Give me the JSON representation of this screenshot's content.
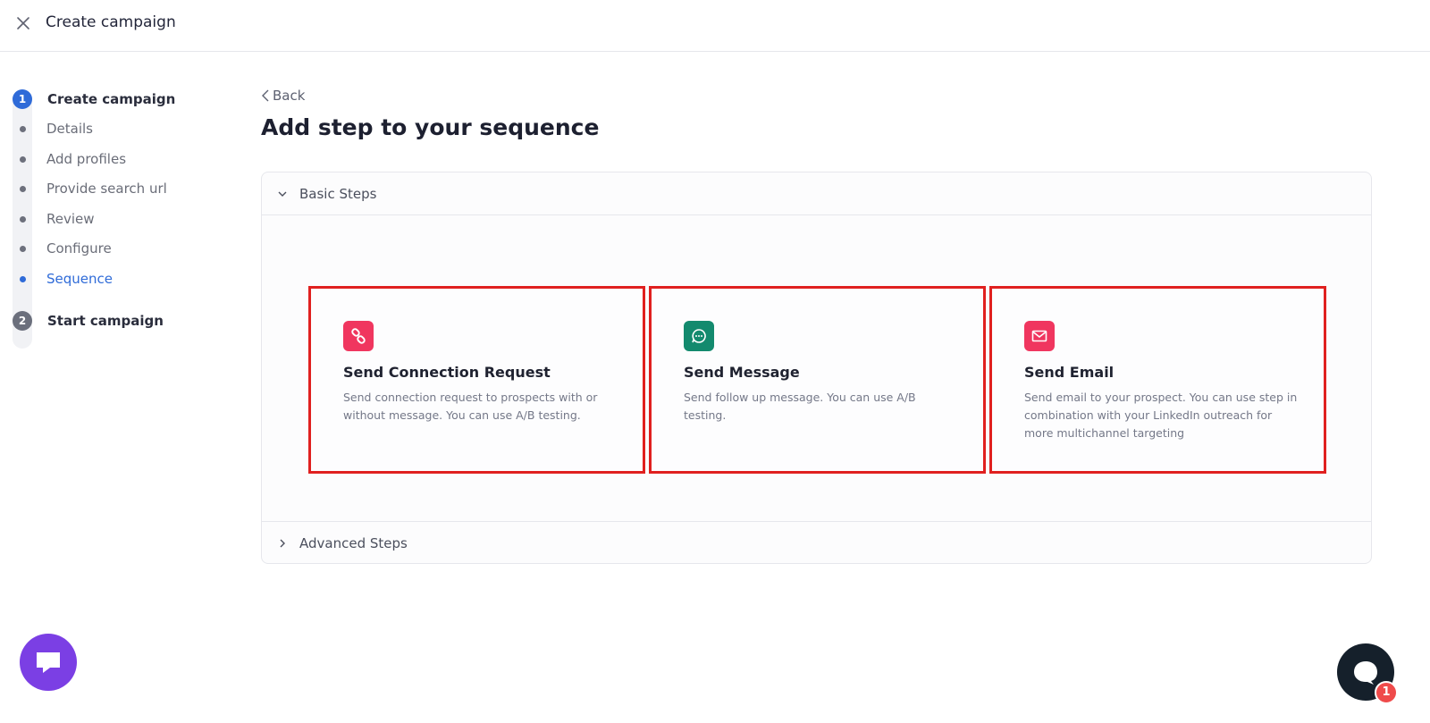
{
  "header": {
    "title": "Create campaign",
    "close_icon": "close-icon"
  },
  "stepper": {
    "steps": [
      {
        "number": "1",
        "label": "Create campaign",
        "state": "active"
      },
      {
        "number": "2",
        "label": "Start campaign",
        "state": "inactive"
      }
    ],
    "substeps": [
      {
        "label": "Details"
      },
      {
        "label": "Add profiles"
      },
      {
        "label": "Provide search url"
      },
      {
        "label": "Review"
      },
      {
        "label": "Configure"
      },
      {
        "label": "Sequence",
        "current": true
      }
    ],
    "active_color": "#2f6bd8"
  },
  "main": {
    "back_label": "Back",
    "heading": "Add step to your sequence",
    "basic_section": {
      "label": "Basic Steps",
      "expanded": true,
      "cards": [
        {
          "title": "Send Connection Request",
          "description": "Send connection request to prospects with or without message. You can use A/B testing.",
          "icon": "link-icon",
          "icon_color": "#f0365f"
        },
        {
          "title": "Send Message",
          "description": "Send follow up message. You can use A/B testing.",
          "icon": "chat-bubble-icon",
          "icon_color": "#138a6e"
        },
        {
          "title": "Send Email",
          "description": "Send email to your prospect. You can use step in combination with your LinkedIn outreach for more multichannel targeting",
          "icon": "mail-icon",
          "icon_color": "#f0365f"
        }
      ]
    },
    "advanced_section": {
      "label": "Advanced Steps",
      "expanded": false
    }
  },
  "widgets": {
    "chat": {
      "icon": "chat-widget-icon",
      "color": "#7b3fe4"
    },
    "help": {
      "icon": "help-widget-icon",
      "color": "#15202b",
      "badge_count": "1"
    }
  },
  "highlight_color": "#e0201f"
}
